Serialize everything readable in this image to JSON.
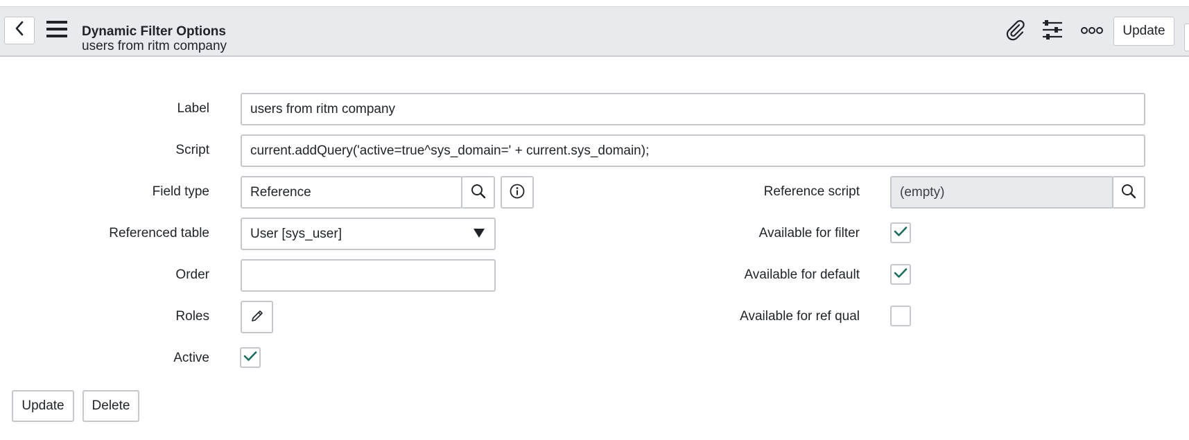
{
  "header": {
    "title": "Dynamic Filter Options",
    "subtitle": "users from ritm company",
    "update_label": "Update",
    "icons": {
      "back": "chevron-left-icon",
      "menu": "hamburger-icon",
      "attachment": "paperclip-icon",
      "personalize": "sliders-icon",
      "more": "more-options-icon"
    }
  },
  "form": {
    "label": {
      "caption": "Label",
      "value": "users from ritm company"
    },
    "script": {
      "caption": "Script",
      "value": "current.addQuery('active=true^sys_domain=' + current.sys_domain);"
    },
    "field_type": {
      "caption": "Field type",
      "value": "Reference"
    },
    "reference_script": {
      "caption": "Reference script",
      "value": "(empty)"
    },
    "referenced_table": {
      "caption": "Referenced table",
      "value": "User [sys_user]"
    },
    "available_for_filter": {
      "caption": "Available for filter",
      "checked": true
    },
    "order": {
      "caption": "Order",
      "value": ""
    },
    "available_for_default": {
      "caption": "Available for default",
      "checked": true
    },
    "roles": {
      "caption": "Roles"
    },
    "available_for_ref_qual": {
      "caption": "Available for ref qual",
      "checked": false
    },
    "active": {
      "caption": "Active",
      "checked": true
    }
  },
  "footer": {
    "update_label": "Update",
    "delete_label": "Delete"
  },
  "colors": {
    "header_bg": "#e8eaed",
    "check_mark": "#1b6b5f",
    "border": "#c4c7cb"
  }
}
